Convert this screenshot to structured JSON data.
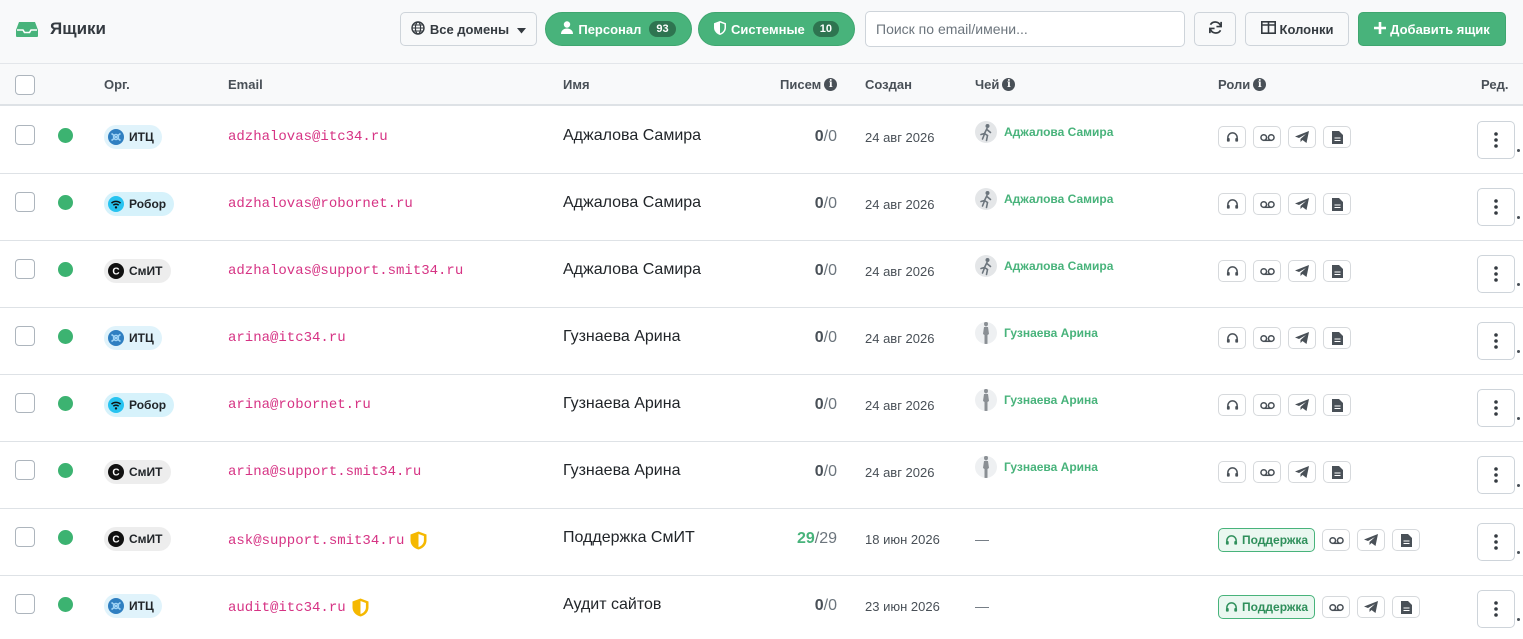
{
  "header": {
    "title": "Ящики",
    "domain_filter": "Все домены",
    "personal_label": "Персонал",
    "personal_count": "93",
    "system_label": "Системные",
    "system_count": "10",
    "search_placeholder": "Поиск по email/имени...",
    "columns_label": "Колонки",
    "add_label": "Добавить ящик"
  },
  "table": {
    "columns": {
      "org": "Орг.",
      "email": "Email",
      "name": "Имя",
      "mail": "Писем",
      "created": "Создан",
      "owner": "Чей",
      "roles": "Роли",
      "edit": "Ред."
    },
    "rows": [
      {
        "org": "ИТЦ",
        "org_type": "itc",
        "email": "adzhalovas@itc34.ru",
        "shield": false,
        "name": "Аджалова Самира",
        "used": "0",
        "total": "/0",
        "created": "24 авг 2026",
        "owner": "Аджалова Самира",
        "owner_avatar": "runner-icon",
        "support_role": false
      },
      {
        "org": "Робор",
        "org_type": "rob",
        "email": "adzhalovas@robornet.ru",
        "shield": false,
        "name": "Аджалова Самира",
        "used": "0",
        "total": "/0",
        "created": "24 авг 2026",
        "owner": "Аджалова Самира",
        "owner_avatar": "runner-icon",
        "support_role": false
      },
      {
        "org": "СмИТ",
        "org_type": "smit",
        "email": "adzhalovas@support.smit34.ru",
        "shield": false,
        "name": "Аджалова Самира",
        "used": "0",
        "total": "/0",
        "created": "24 авг 2026",
        "owner": "Аджалова Самира",
        "owner_avatar": "runner-icon",
        "support_role": false
      },
      {
        "org": "ИТЦ",
        "org_type": "itc",
        "email": "arina@itc34.ru",
        "shield": false,
        "name": "Гузнаева Арина",
        "used": "0",
        "total": "/0",
        "created": "24 авг 2026",
        "owner": "Гузнаева Арина",
        "owner_avatar": "figure-icon",
        "support_role": false
      },
      {
        "org": "Робор",
        "org_type": "rob",
        "email": "arina@robornet.ru",
        "shield": false,
        "name": "Гузнаева Арина",
        "used": "0",
        "total": "/0",
        "created": "24 авг 2026",
        "owner": "Гузнаева Арина",
        "owner_avatar": "figure-icon",
        "support_role": false
      },
      {
        "org": "СмИТ",
        "org_type": "smit",
        "email": "arina@support.smit34.ru",
        "shield": false,
        "name": "Гузнаева Арина",
        "used": "0",
        "total": "/0",
        "created": "24 авг 2026",
        "owner": "Гузнаева Арина",
        "owner_avatar": "figure-icon",
        "support_role": false
      },
      {
        "org": "СмИТ",
        "org_type": "smit",
        "email": "ask@support.smit34.ru",
        "shield": true,
        "name": "Поддержка СмИТ",
        "used": "29",
        "total": "/29",
        "created": "18 июн 2026",
        "owner": "—",
        "owner_avatar": "",
        "support_role": true,
        "support_label": "Поддержка"
      },
      {
        "org": "ИТЦ",
        "org_type": "itc",
        "email": "audit@itc34.ru",
        "shield": true,
        "name": "Аудит сайтов",
        "used": "0",
        "total": "/0",
        "created": "23 июн 2026",
        "owner": "—",
        "owner_avatar": "",
        "support_role": true,
        "support_label": "Поддержка"
      }
    ]
  },
  "icons": {
    "title": "inbox-icon",
    "domain": "globe-icon",
    "personal": "user-icon",
    "system": "shield-icon",
    "refresh": "refresh-icon",
    "columns": "columns-icon",
    "add": "plus-icon",
    "roles": [
      "headset-icon",
      "voicemail-icon",
      "telegram-icon",
      "document-icon"
    ],
    "edit": "kebab-icon"
  },
  "colors": {
    "accent": "#48b37b",
    "email": "#d63384",
    "status_active": "#3cb371",
    "system_shield": "#f5b800"
  }
}
